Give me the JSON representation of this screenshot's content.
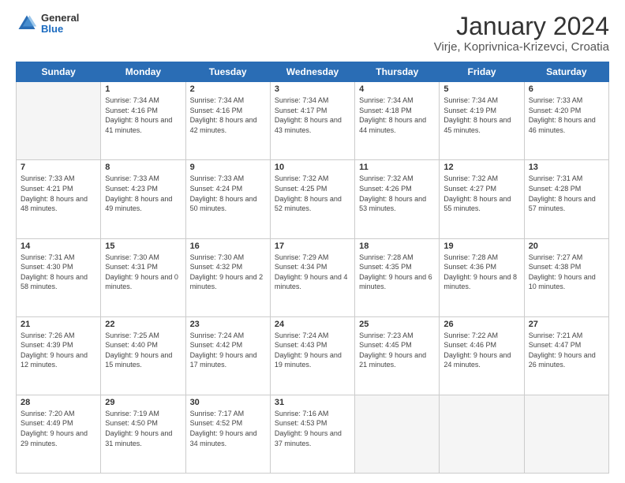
{
  "header": {
    "logo": {
      "general": "General",
      "blue": "Blue"
    },
    "title": "January 2024",
    "subtitle": "Virje, Koprivnica-Krizevci, Croatia"
  },
  "days_header": [
    "Sunday",
    "Monday",
    "Tuesday",
    "Wednesday",
    "Thursday",
    "Friday",
    "Saturday"
  ],
  "weeks": [
    [
      {
        "day": "",
        "sunrise": "",
        "sunset": "",
        "daylight": "",
        "empty": true
      },
      {
        "day": "1",
        "sunrise": "Sunrise: 7:34 AM",
        "sunset": "Sunset: 4:16 PM",
        "daylight": "Daylight: 8 hours and 41 minutes."
      },
      {
        "day": "2",
        "sunrise": "Sunrise: 7:34 AM",
        "sunset": "Sunset: 4:16 PM",
        "daylight": "Daylight: 8 hours and 42 minutes."
      },
      {
        "day": "3",
        "sunrise": "Sunrise: 7:34 AM",
        "sunset": "Sunset: 4:17 PM",
        "daylight": "Daylight: 8 hours and 43 minutes."
      },
      {
        "day": "4",
        "sunrise": "Sunrise: 7:34 AM",
        "sunset": "Sunset: 4:18 PM",
        "daylight": "Daylight: 8 hours and 44 minutes."
      },
      {
        "day": "5",
        "sunrise": "Sunrise: 7:34 AM",
        "sunset": "Sunset: 4:19 PM",
        "daylight": "Daylight: 8 hours and 45 minutes."
      },
      {
        "day": "6",
        "sunrise": "Sunrise: 7:33 AM",
        "sunset": "Sunset: 4:20 PM",
        "daylight": "Daylight: 8 hours and 46 minutes."
      }
    ],
    [
      {
        "day": "7",
        "sunrise": "Sunrise: 7:33 AM",
        "sunset": "Sunset: 4:21 PM",
        "daylight": "Daylight: 8 hours and 48 minutes."
      },
      {
        "day": "8",
        "sunrise": "Sunrise: 7:33 AM",
        "sunset": "Sunset: 4:23 PM",
        "daylight": "Daylight: 8 hours and 49 minutes."
      },
      {
        "day": "9",
        "sunrise": "Sunrise: 7:33 AM",
        "sunset": "Sunset: 4:24 PM",
        "daylight": "Daylight: 8 hours and 50 minutes."
      },
      {
        "day": "10",
        "sunrise": "Sunrise: 7:32 AM",
        "sunset": "Sunset: 4:25 PM",
        "daylight": "Daylight: 8 hours and 52 minutes."
      },
      {
        "day": "11",
        "sunrise": "Sunrise: 7:32 AM",
        "sunset": "Sunset: 4:26 PM",
        "daylight": "Daylight: 8 hours and 53 minutes."
      },
      {
        "day": "12",
        "sunrise": "Sunrise: 7:32 AM",
        "sunset": "Sunset: 4:27 PM",
        "daylight": "Daylight: 8 hours and 55 minutes."
      },
      {
        "day": "13",
        "sunrise": "Sunrise: 7:31 AM",
        "sunset": "Sunset: 4:28 PM",
        "daylight": "Daylight: 8 hours and 57 minutes."
      }
    ],
    [
      {
        "day": "14",
        "sunrise": "Sunrise: 7:31 AM",
        "sunset": "Sunset: 4:30 PM",
        "daylight": "Daylight: 8 hours and 58 minutes."
      },
      {
        "day": "15",
        "sunrise": "Sunrise: 7:30 AM",
        "sunset": "Sunset: 4:31 PM",
        "daylight": "Daylight: 9 hours and 0 minutes."
      },
      {
        "day": "16",
        "sunrise": "Sunrise: 7:30 AM",
        "sunset": "Sunset: 4:32 PM",
        "daylight": "Daylight: 9 hours and 2 minutes."
      },
      {
        "day": "17",
        "sunrise": "Sunrise: 7:29 AM",
        "sunset": "Sunset: 4:34 PM",
        "daylight": "Daylight: 9 hours and 4 minutes."
      },
      {
        "day": "18",
        "sunrise": "Sunrise: 7:28 AM",
        "sunset": "Sunset: 4:35 PM",
        "daylight": "Daylight: 9 hours and 6 minutes."
      },
      {
        "day": "19",
        "sunrise": "Sunrise: 7:28 AM",
        "sunset": "Sunset: 4:36 PM",
        "daylight": "Daylight: 9 hours and 8 minutes."
      },
      {
        "day": "20",
        "sunrise": "Sunrise: 7:27 AM",
        "sunset": "Sunset: 4:38 PM",
        "daylight": "Daylight: 9 hours and 10 minutes."
      }
    ],
    [
      {
        "day": "21",
        "sunrise": "Sunrise: 7:26 AM",
        "sunset": "Sunset: 4:39 PM",
        "daylight": "Daylight: 9 hours and 12 minutes."
      },
      {
        "day": "22",
        "sunrise": "Sunrise: 7:25 AM",
        "sunset": "Sunset: 4:40 PM",
        "daylight": "Daylight: 9 hours and 15 minutes."
      },
      {
        "day": "23",
        "sunrise": "Sunrise: 7:24 AM",
        "sunset": "Sunset: 4:42 PM",
        "daylight": "Daylight: 9 hours and 17 minutes."
      },
      {
        "day": "24",
        "sunrise": "Sunrise: 7:24 AM",
        "sunset": "Sunset: 4:43 PM",
        "daylight": "Daylight: 9 hours and 19 minutes."
      },
      {
        "day": "25",
        "sunrise": "Sunrise: 7:23 AM",
        "sunset": "Sunset: 4:45 PM",
        "daylight": "Daylight: 9 hours and 21 minutes."
      },
      {
        "day": "26",
        "sunrise": "Sunrise: 7:22 AM",
        "sunset": "Sunset: 4:46 PM",
        "daylight": "Daylight: 9 hours and 24 minutes."
      },
      {
        "day": "27",
        "sunrise": "Sunrise: 7:21 AM",
        "sunset": "Sunset: 4:47 PM",
        "daylight": "Daylight: 9 hours and 26 minutes."
      }
    ],
    [
      {
        "day": "28",
        "sunrise": "Sunrise: 7:20 AM",
        "sunset": "Sunset: 4:49 PM",
        "daylight": "Daylight: 9 hours and 29 minutes."
      },
      {
        "day": "29",
        "sunrise": "Sunrise: 7:19 AM",
        "sunset": "Sunset: 4:50 PM",
        "daylight": "Daylight: 9 hours and 31 minutes."
      },
      {
        "day": "30",
        "sunrise": "Sunrise: 7:17 AM",
        "sunset": "Sunset: 4:52 PM",
        "daylight": "Daylight: 9 hours and 34 minutes."
      },
      {
        "day": "31",
        "sunrise": "Sunrise: 7:16 AM",
        "sunset": "Sunset: 4:53 PM",
        "daylight": "Daylight: 9 hours and 37 minutes."
      },
      {
        "day": "",
        "sunrise": "",
        "sunset": "",
        "daylight": "",
        "empty": true
      },
      {
        "day": "",
        "sunrise": "",
        "sunset": "",
        "daylight": "",
        "empty": true
      },
      {
        "day": "",
        "sunrise": "",
        "sunset": "",
        "daylight": "",
        "empty": true
      }
    ]
  ]
}
